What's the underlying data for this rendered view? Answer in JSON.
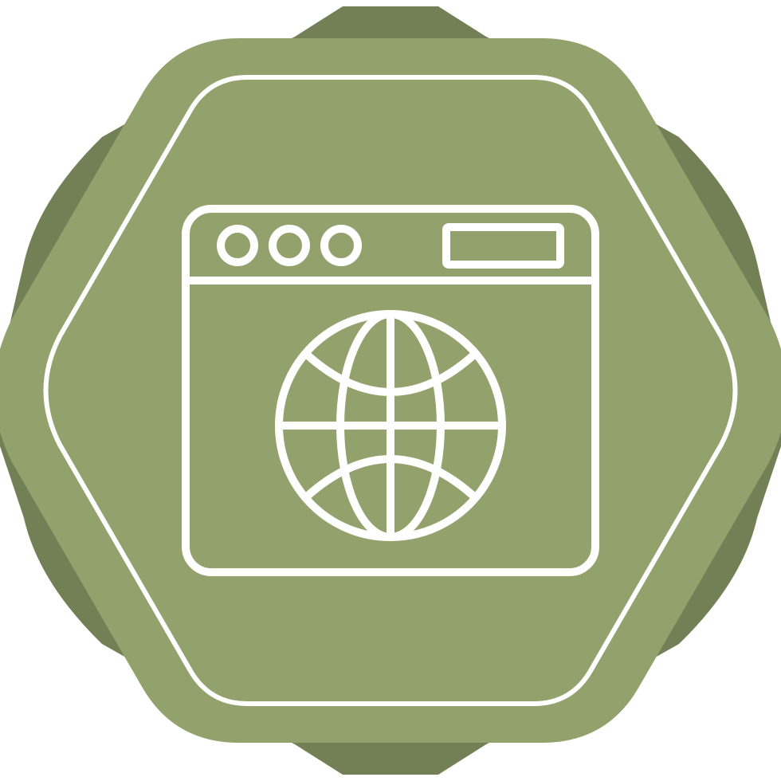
{
  "icon": {
    "name": "web-browser-globe-icon",
    "colors": {
      "background": "#ffffff",
      "badge_back": "#738056",
      "badge_front": "#93a26c",
      "line": "#ffffff"
    }
  }
}
